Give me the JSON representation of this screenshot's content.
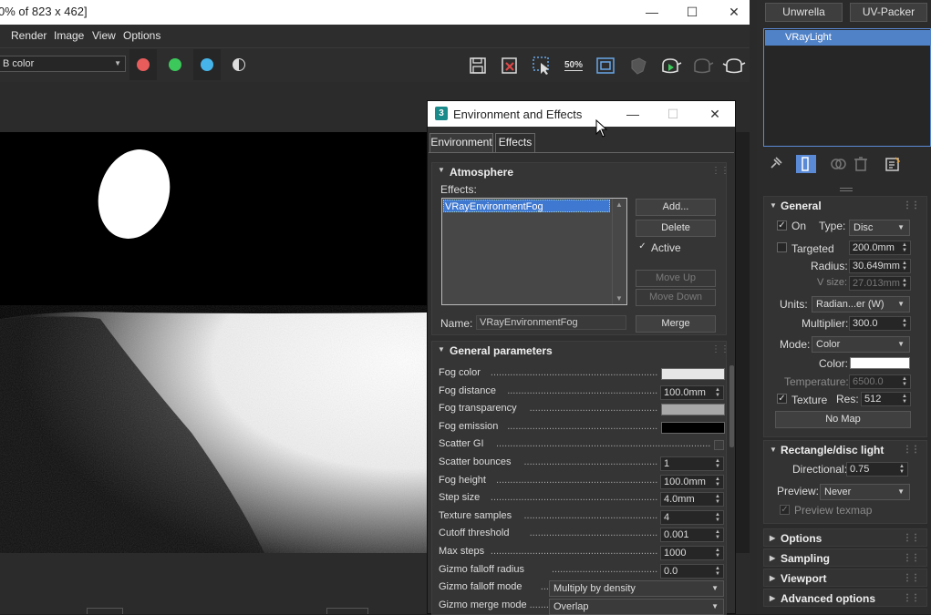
{
  "window": {
    "title": "0% of 823 x 462]"
  },
  "menu": [
    "Render",
    "Image",
    "View",
    "Options"
  ],
  "toolbar": {
    "channel_select": "B color",
    "channel_colors": [
      "#e85c5c",
      "#3cc85a",
      "#46b4e8"
    ],
    "icons": [
      "save-icon",
      "clear-icon",
      "region-select-icon",
      "zoom-50-icon",
      "frame-icon",
      "shield-icon",
      "render-teapot-icon",
      "render-region-teapot-icon",
      "teapot-icon"
    ],
    "zoom_label": "50%"
  },
  "command_panel": {
    "buttons": [
      "Unwrella",
      "UV-Packer"
    ],
    "selected_object": "VRayLight",
    "general": {
      "title": "General",
      "on_label": "On",
      "on_checked": true,
      "type_label": "Type:",
      "type_value": "Disc",
      "targeted_label": "Targeted",
      "targeted_checked": false,
      "targeted_value": "200.0mm",
      "radius_label": "Radius:",
      "radius_value": "30.649mm",
      "vsize_label": "V size:",
      "vsize_value": "27.013mm",
      "units_label": "Units:",
      "units_value": "Radian...er (W)",
      "multiplier_label": "Multiplier:",
      "multiplier_value": "300.0",
      "mode_label": "Mode:",
      "mode_value": "Color",
      "color_label": "Color:",
      "color_value": "#ffffff",
      "temperature_label": "Temperature:",
      "temperature_value": "6500.0",
      "texture_label": "Texture",
      "texture_checked": true,
      "res_label": "Res:",
      "res_value": "512",
      "nomap_label": "No Map"
    },
    "rectangle": {
      "title": "Rectangle/disc light",
      "directional_label": "Directional:",
      "directional_value": "0.75",
      "preview_label": "Preview:",
      "preview_value": "Never",
      "preview_texmap_label": "Preview texmap"
    },
    "rollouts": [
      "Options",
      "Sampling",
      "Viewport",
      "Advanced options"
    ]
  },
  "dialog": {
    "title": "Environment and Effects",
    "tabs": [
      "Environment",
      "Effects"
    ],
    "atmosphere": {
      "title": "Atmosphere",
      "effects_label": "Effects:",
      "effects_list": [
        "VRayEnvironmentFog"
      ],
      "add": "Add...",
      "delete": "Delete",
      "active": "Active",
      "move_up": "Move Up",
      "move_down": "Move Down",
      "name_label": "Name:",
      "name_value": "VRayEnvironmentFog",
      "merge": "Merge"
    },
    "general": {
      "title": "General parameters",
      "params": [
        {
          "label": "Fog color",
          "value": "",
          "kind": "swatch",
          "color": "#e6e6e6"
        },
        {
          "label": "Fog distance",
          "value": "100.0mm",
          "kind": "spin"
        },
        {
          "label": "Fog transparency",
          "value": "",
          "kind": "swatch",
          "color": "#a8a8a8"
        },
        {
          "label": "Fog emission",
          "value": "",
          "kind": "swatch",
          "color": "#000000"
        },
        {
          "label": "Scatter GI",
          "value": "",
          "kind": "check"
        },
        {
          "label": "Scatter bounces",
          "value": "1",
          "kind": "spin"
        },
        {
          "label": "Fog height",
          "value": "100.0mm",
          "kind": "spin"
        },
        {
          "label": "Step size",
          "value": "4.0mm",
          "kind": "spin"
        },
        {
          "label": "Texture samples",
          "value": "4",
          "kind": "spin"
        },
        {
          "label": "Cutoff threshold",
          "value": "0.001",
          "kind": "spin"
        },
        {
          "label": "Max steps",
          "value": "1000",
          "kind": "spin"
        },
        {
          "label": "Gizmo falloff radius",
          "value": "0.0",
          "kind": "spin"
        },
        {
          "label": "Gizmo falloff mode",
          "value": "Multiply by density",
          "kind": "drop"
        },
        {
          "label": "Gizmo merge mode",
          "value": "Overlap",
          "kind": "drop"
        }
      ]
    }
  }
}
